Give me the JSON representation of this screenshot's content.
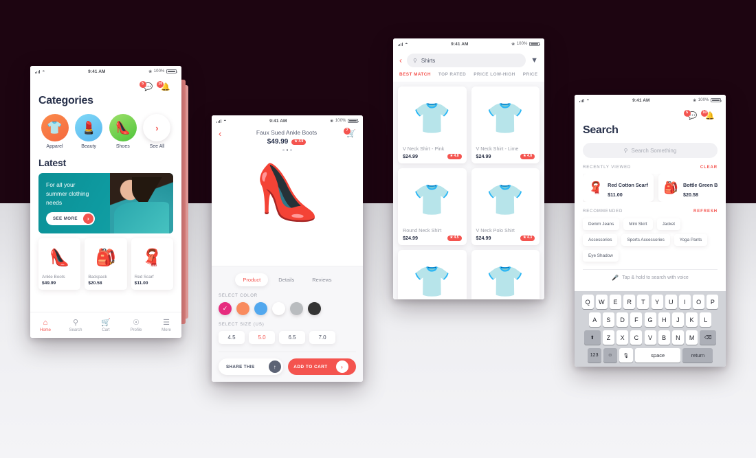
{
  "theme": {
    "accent": "#f4544f",
    "dark_bg": "#1d0511",
    "light_bg": "#eeeef1",
    "teal": "#0e9aa0"
  },
  "status_bar": {
    "time": "9:41 AM",
    "battery": "100%"
  },
  "home": {
    "badges": {
      "messages": "5",
      "notifications": "10"
    },
    "title": "Categories",
    "categories": [
      {
        "label": "Apparel",
        "icon": "shirt-icon"
      },
      {
        "label": "Beauty",
        "icon": "lipstick-icon"
      },
      {
        "label": "Shoes",
        "icon": "heel-icon"
      },
      {
        "label": "See All",
        "icon": "chevron-right-icon"
      }
    ],
    "latest_title": "Latest",
    "promo": {
      "line1": "For all your",
      "line2": "summer clothing",
      "line3": "needs",
      "cta": "SEE MORE"
    },
    "products": [
      {
        "name": "Ankle Boots",
        "price": "$49.99",
        "icon": "boots-icon"
      },
      {
        "name": "Backpack",
        "price": "$20.58",
        "icon": "backpack-icon"
      },
      {
        "name": "Red Scarf",
        "price": "$11.00",
        "icon": "scarf-icon"
      }
    ],
    "tabs": [
      {
        "label": "Home",
        "icon": "home-icon",
        "active": true
      },
      {
        "label": "Search",
        "icon": "search-icon",
        "active": false
      },
      {
        "label": "Cart",
        "icon": "cart-icon",
        "active": false
      },
      {
        "label": "Profile",
        "icon": "profile-icon",
        "active": false
      },
      {
        "label": "More",
        "icon": "menu-icon",
        "active": false
      }
    ]
  },
  "product": {
    "title": "Faux Sued Ankle Boots",
    "price": "$49.99",
    "rating": "4.9",
    "cart_badge": "7",
    "tabs": [
      {
        "label": "Product",
        "active": true
      },
      {
        "label": "Details",
        "active": false
      },
      {
        "label": "Reviews",
        "active": false
      }
    ],
    "color_label": "SELECT COLOR",
    "colors": [
      {
        "name": "pink",
        "hex": "#e62c7e",
        "selected": true
      },
      {
        "name": "orange",
        "hex": "#f98b5e",
        "selected": false
      },
      {
        "name": "blue",
        "hex": "#52a8ee",
        "selected": false
      },
      {
        "name": "white",
        "hex": "#ffffff",
        "selected": false
      },
      {
        "name": "gray",
        "hex": "#b9bcbf",
        "selected": false
      },
      {
        "name": "black",
        "hex": "#343434",
        "selected": false
      }
    ],
    "size_label": "SELECT SIZE (US)",
    "sizes": [
      {
        "value": "4.5",
        "selected": false
      },
      {
        "value": "5.0",
        "selected": true
      },
      {
        "value": "6.5",
        "selected": false
      },
      {
        "value": "7.0",
        "selected": false
      }
    ],
    "share_label": "SHARE THIS",
    "cart_label": "ADD TO CART"
  },
  "results": {
    "query": "Shirts",
    "sorts": [
      {
        "label": "BEST MATCH",
        "active": true
      },
      {
        "label": "TOP RATED",
        "active": false
      },
      {
        "label": "PRICE LOW-HIGH",
        "active": false
      },
      {
        "label": "PRICE",
        "active": false
      }
    ],
    "items": [
      {
        "name": "V Neck Shirt - Pink",
        "price": "$24.99",
        "rating": "4.8",
        "color": "#e8377f"
      },
      {
        "name": "V Neck Shirt - Lime",
        "price": "$24.99",
        "rating": "4.8",
        "color": "#c8e022"
      },
      {
        "name": "Round Neck Shirt",
        "price": "$24.99",
        "rating": "4.5",
        "color": "#18b5d8"
      },
      {
        "name": "V Neck Polo Shirt",
        "price": "$24.99",
        "rating": "4.3",
        "color": "#8c2d8a"
      },
      {
        "name": "",
        "price": "",
        "rating": "",
        "color": "#4b7f7a"
      },
      {
        "name": "",
        "price": "",
        "rating": "",
        "color": "#7b93b8"
      }
    ]
  },
  "search": {
    "badges": {
      "messages": "5",
      "notifications": "10"
    },
    "title": "Search",
    "placeholder": "Search Something",
    "recent_label": "RECENTLY VIEWED",
    "clear_label": "CLEAR",
    "recent_items": [
      {
        "name": "Red Cotton Scarf",
        "price": "$11.00",
        "icon": "scarf-icon"
      },
      {
        "name": "Bottle Green Ba",
        "price": "$20.58",
        "icon": "backpack-icon"
      }
    ],
    "recommended_label": "RECOMMENDED",
    "refresh_label": "REFRESH",
    "chips": [
      "Denim Jeans",
      "Mini Skirt",
      "Jacket",
      "Accessories",
      "Sports Accessories",
      "Yoga Pants",
      "Eye Shadow"
    ],
    "voice_hint": "Tap & hold to search with voice",
    "keyboard": {
      "row1": [
        "Q",
        "W",
        "E",
        "R",
        "T",
        "Y",
        "U",
        "I",
        "O",
        "P"
      ],
      "row2": [
        "A",
        "S",
        "D",
        "F",
        "G",
        "H",
        "J",
        "K",
        "L"
      ],
      "row3": [
        "Z",
        "X",
        "C",
        "V",
        "B",
        "N",
        "M"
      ],
      "shift": "⬆",
      "backspace": "⌫",
      "numeric": "123",
      "emoji": "☺",
      "mic": "🎙",
      "space": "space",
      "return": "return"
    }
  }
}
